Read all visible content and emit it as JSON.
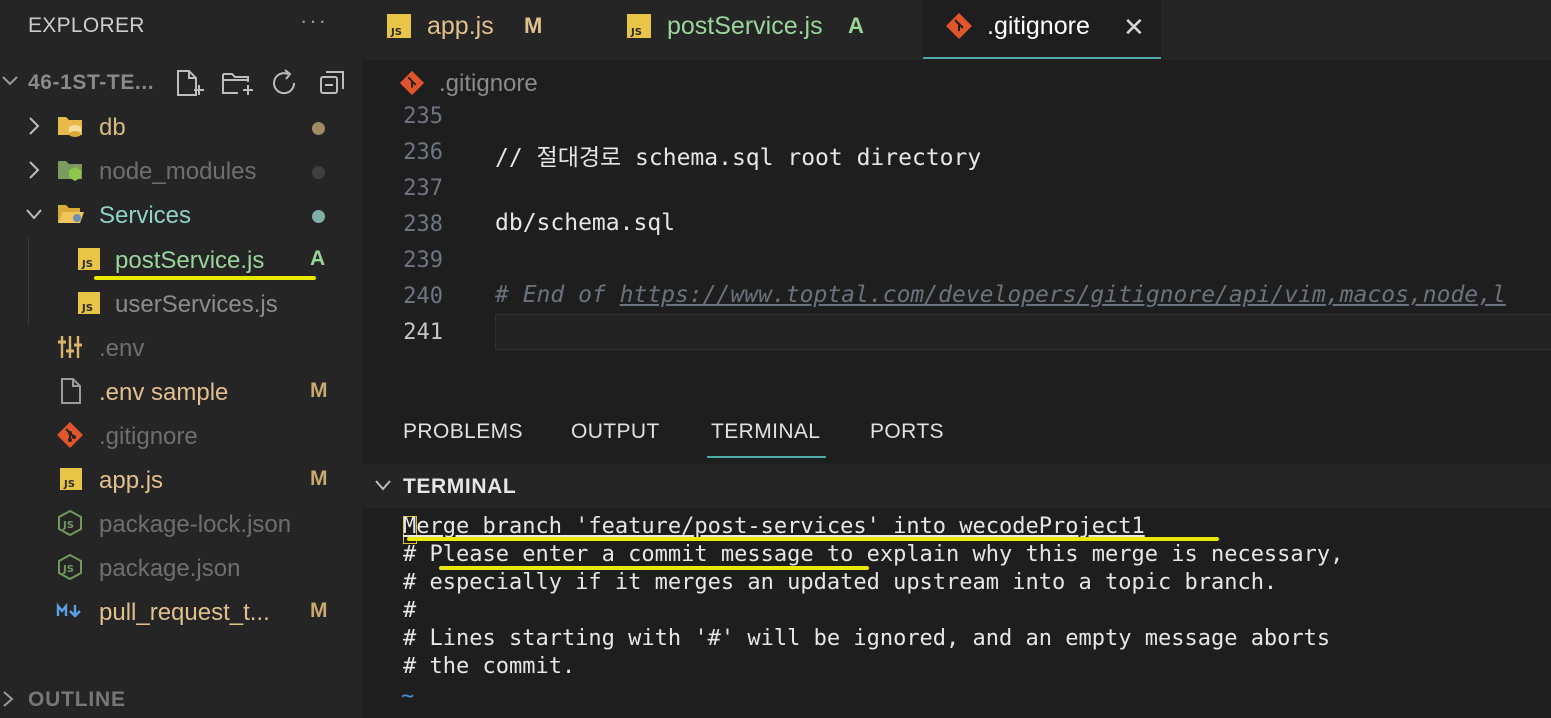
{
  "sidebar": {
    "title": "EXPLORER",
    "more": "···",
    "root": "46-1ST-TE...",
    "items": [
      {
        "label": "db",
        "color": "#d7ba7d",
        "dot": "#a08a63"
      },
      {
        "label": "node_modules",
        "color": "#6f6f6f",
        "dot": "#3f3f3f"
      },
      {
        "label": "Services",
        "color": "#8fd3c6",
        "dot": "#7fb0a8"
      },
      {
        "label": "postService.js",
        "color": "#9ad59a",
        "badge": "A",
        "badge_color": "#9ad59a"
      },
      {
        "label": "userServices.js",
        "color": "#8c8c8c"
      },
      {
        "label": ".env",
        "color": "#6f6f6f"
      },
      {
        "label": ".env sample",
        "color": "#e2c08d",
        "badge": "M",
        "badge_color": "#c9a96e"
      },
      {
        "label": ".gitignore",
        "color": "#6f6f6f"
      },
      {
        "label": "app.js",
        "color": "#e2c08d",
        "badge": "M",
        "badge_color": "#c9a96e"
      },
      {
        "label": "package-lock.json",
        "color": "#6f6f6f"
      },
      {
        "label": "package.json",
        "color": "#6f6f6f"
      },
      {
        "label": "pull_request_t...",
        "color": "#e2c08d",
        "badge": "M",
        "badge_color": "#c9a96e"
      }
    ],
    "outline": "OUTLINE"
  },
  "tabs": [
    {
      "label": "app.js",
      "badge": "M",
      "color": "#e2c08d"
    },
    {
      "label": "postService.js",
      "badge": "A",
      "color": "#9ad59a"
    },
    {
      "label": ".gitignore",
      "close": "✕",
      "color": "#ffffff"
    }
  ],
  "breadcrumb": ".gitignore",
  "editor": {
    "lines": [
      {
        "num": "235",
        "text": ""
      },
      {
        "num": "236",
        "text": "// 절대경로 schema.sql root directory"
      },
      {
        "num": "237",
        "text": ""
      },
      {
        "num": "238",
        "text": "db/schema.sql"
      },
      {
        "num": "239",
        "text": ""
      },
      {
        "num": "240",
        "comment_prefix": "# End of ",
        "url": "https://www.toptal.com/developers/gitignore/api/vim,macos,node,l"
      },
      {
        "num": "241",
        "text": ""
      }
    ]
  },
  "panel": {
    "tabs": [
      "PROBLEMS",
      "OUTPUT",
      "TERMINAL",
      "PORTS"
    ],
    "terminal_title": "TERMINAL",
    "lines": [
      "Merge branch 'feature/post-services' into wecodeProject1",
      "# Please enter a commit message to explain why this merge is necessary,",
      "# especially if it merges an updated upstream into a topic branch.",
      "#",
      "# Lines starting with '#' will be ignored, and an empty message aborts",
      "# the commit."
    ],
    "tilde": "~"
  },
  "colors": {
    "accent": "#4ea9a4",
    "highlight": "#e8e800",
    "git_orange": "#e0552b",
    "js_yellow": "#e8c547"
  }
}
